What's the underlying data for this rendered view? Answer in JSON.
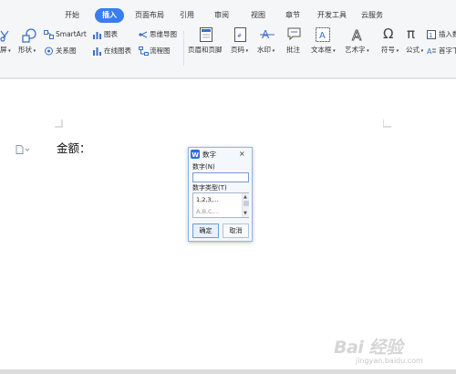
{
  "ribbon": {
    "tabs": [
      {
        "label": "开始",
        "active": false
      },
      {
        "label": "插入",
        "active": true
      },
      {
        "label": "页面布局",
        "active": false
      },
      {
        "label": "引用",
        "active": false
      },
      {
        "label": "审阅",
        "active": false
      },
      {
        "label": "视图",
        "active": false
      },
      {
        "label": "章节",
        "active": false
      },
      {
        "label": "开发工具",
        "active": false
      },
      {
        "label": "云服务",
        "active": false
      }
    ],
    "tools": {
      "screen": "屏",
      "shapes": "形状",
      "smartart": "SmartArt",
      "relation": "关系图",
      "chart": "图表",
      "online_chart": "在线图表",
      "mindmap": "思维导图",
      "flowchart": "流程图",
      "header_footer": "页眉和页脚",
      "page_number": "页码",
      "watermark": "水印",
      "comment": "批注",
      "textbox": "文本框",
      "wordart": "艺术字",
      "symbol": "符号",
      "formula": "公式",
      "insert_num": "插入数",
      "dropcap": "首字下"
    },
    "accent_color": "#3a7df0"
  },
  "document": {
    "text": "金额："
  },
  "dialog": {
    "icon_label": "W",
    "title": "数字",
    "close": "×",
    "number_label": "数字(N)",
    "number_value": "",
    "type_label": "数字类型(T)",
    "options": [
      "1,2,3,...",
      "A,B,C,..."
    ],
    "selected_option": "1,2,3,...",
    "ok": "确定",
    "cancel": "取消",
    "border_color": "#8fb6e3"
  },
  "watermark": {
    "text": "Bai 经验",
    "sub": "jingyan.baidu.com"
  }
}
